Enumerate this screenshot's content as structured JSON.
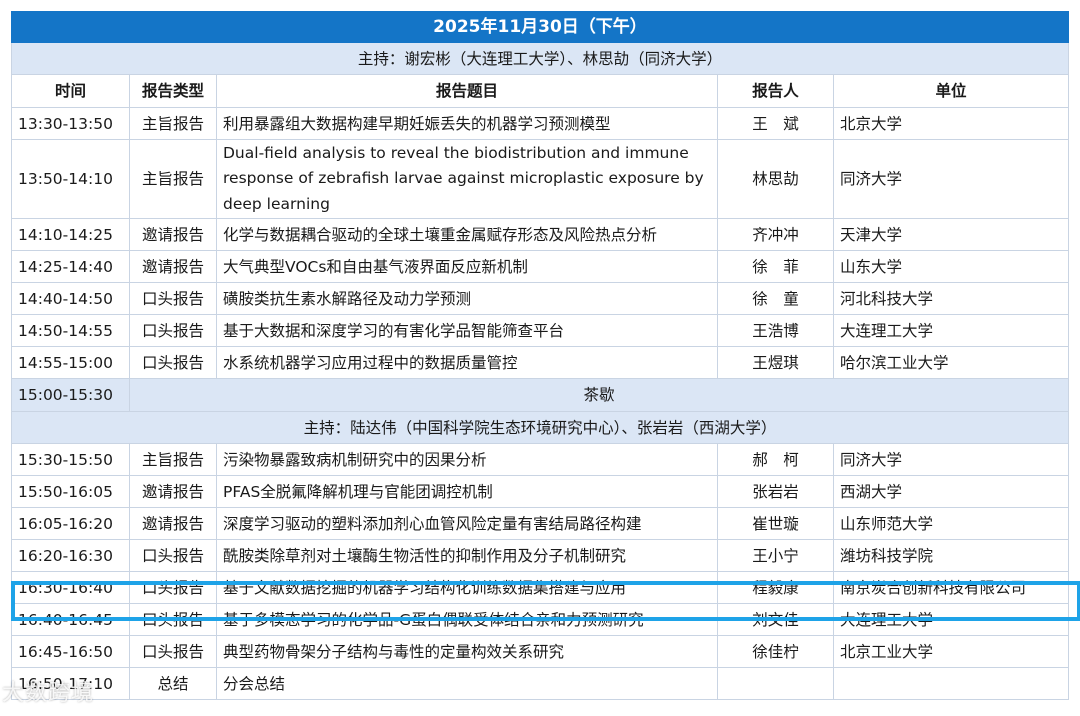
{
  "title": "2025年11月30日（下午）",
  "columns": {
    "time": "时间",
    "type": "报告类型",
    "topic": "报告题目",
    "speaker": "报告人",
    "unit": "单位"
  },
  "session1": {
    "host": "主持：谢宏彬（大连理工大学）、林思劼（同济大学）",
    "rows": [
      {
        "time": "13:30-13:50",
        "type": "主旨报告",
        "topic": "利用暴露组大数据构建早期妊娠丢失的机器学习预测模型",
        "speaker": "王　斌",
        "unit": "北京大学"
      },
      {
        "time": "13:50-14:10",
        "type": "主旨报告",
        "topic": "Dual-field analysis to reveal the biodistribution and immune response of zebrafish larvae against microplastic exposure by deep learning",
        "speaker": "林思劼",
        "unit": "同济大学"
      },
      {
        "time": "14:10-14:25",
        "type": "邀请报告",
        "topic": "化学与数据耦合驱动的全球土壤重金属赋存形态及风险热点分析",
        "speaker": "齐冲冲",
        "unit": "天津大学"
      },
      {
        "time": "14:25-14:40",
        "type": "邀请报告",
        "topic": "大气典型VOCs和自由基气液界面反应新机制",
        "speaker": "徐　菲",
        "unit": "山东大学"
      },
      {
        "time": "14:40-14:50",
        "type": "口头报告",
        "topic": "磺胺类抗生素水解路径及动力学预测",
        "speaker": "徐　童",
        "unit": "河北科技大学"
      },
      {
        "time": "14:50-14:55",
        "type": "口头报告",
        "topic": "基于大数据和深度学习的有害化学品智能筛查平台",
        "speaker": "王浩博",
        "unit": "大连理工大学"
      },
      {
        "time": "14:55-15:00",
        "type": "口头报告",
        "topic": "水系统机器学习应用过程中的数据质量管控",
        "speaker": "王煜琪",
        "unit": "哈尔滨工业大学"
      }
    ]
  },
  "tea_break": {
    "time": "15:00-15:30",
    "label": "茶歇"
  },
  "session2": {
    "host": "主持：陆达伟（中国科学院生态环境研究中心）、张岩岩（西湖大学）",
    "rows": [
      {
        "time": "15:30-15:50",
        "type": "主旨报告",
        "topic": "污染物暴露致病机制研究中的因果分析",
        "speaker": "郝　柯",
        "unit": "同济大学"
      },
      {
        "time": "15:50-16:05",
        "type": "邀请报告",
        "topic": "PFAS全脱氟降解机理与官能团调控机制",
        "speaker": "张岩岩",
        "unit": "西湖大学"
      },
      {
        "time": "16:05-16:20",
        "type": "邀请报告",
        "topic": "深度学习驱动的塑料添加剂心血管风险定量有害结局路径构建",
        "speaker": "崔世璇",
        "unit": "山东师范大学"
      },
      {
        "time": "16:20-16:30",
        "type": "口头报告",
        "topic": "酰胺类除草剂对土壤酶生物活性的抑制作用及分子机制研究",
        "speaker": "王小宁",
        "unit": "潍坊科技学院"
      },
      {
        "time": "16:30-16:40",
        "type": "口头报告",
        "topic": "基于文献数据挖掘的机器学习结构化训练数据集搭建与应用",
        "speaker": "程毅康",
        "unit": "南京炭合创新科技有限公司"
      },
      {
        "time": "16:40-16:45",
        "type": "口头报告",
        "topic": "基于多模态学习的化学品-G蛋白偶联受体结合亲和力预测研究",
        "speaker": "刘文佳",
        "unit": "大连理工大学"
      },
      {
        "time": "16:45-16:50",
        "type": "口头报告",
        "topic": "典型药物骨架分子结构与毒性的定量构效关系研究",
        "speaker": "徐佳柠",
        "unit": "北京工业大学"
      },
      {
        "time": "16:50-17:10",
        "type": "总结",
        "topic": "分会总结",
        "speaker": "",
        "unit": ""
      }
    ]
  },
  "watermark": "大数跨境",
  "colors": {
    "title_bg": "#1475c7",
    "host_bg": "#dbe6f5",
    "highlight_border": "#1ea3e8",
    "grid": "#c9d4e3"
  }
}
